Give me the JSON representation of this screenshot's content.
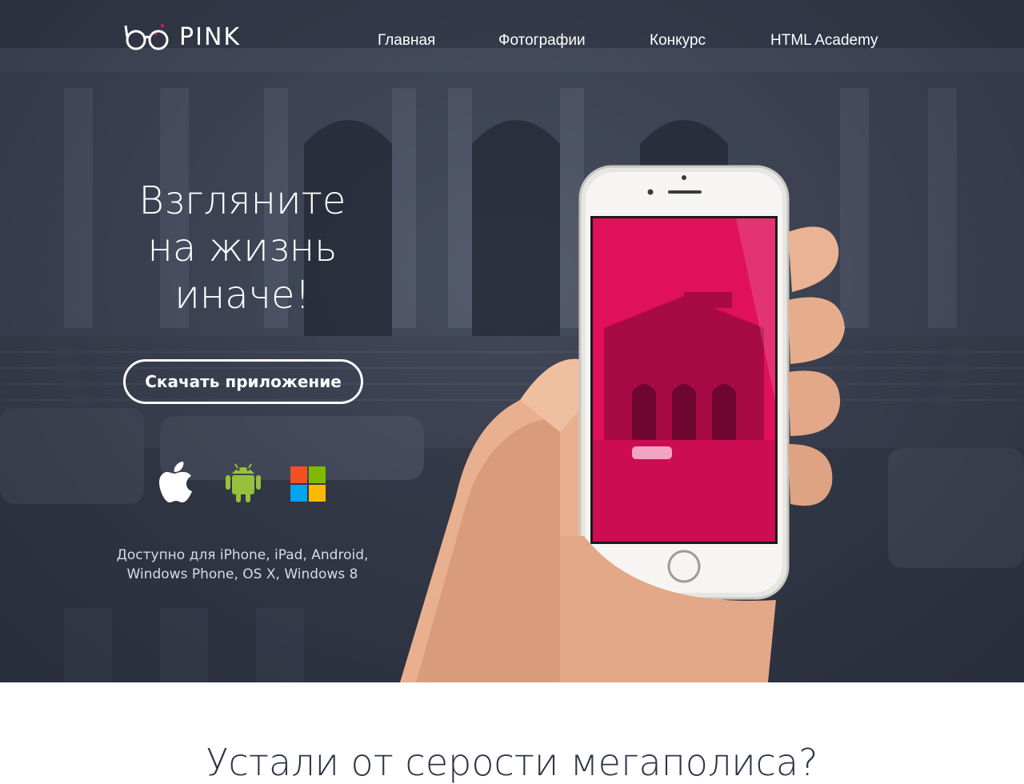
{
  "header": {
    "logo_text": "PINK",
    "nav": [
      {
        "label": "Главная"
      },
      {
        "label": "Фотографии"
      },
      {
        "label": "Конкурс"
      },
      {
        "label": "HTML Academy"
      }
    ]
  },
  "hero": {
    "headline_lines": [
      "Взгляните",
      "на жизнь",
      "иначе!"
    ],
    "download_button": "Скачать приложение",
    "platform_icons": [
      "apple-icon",
      "android-icon",
      "windows-icon"
    ],
    "available_lines": [
      "Доступно для iPhone, iPad, Android,",
      "Windows Phone, OS X, Windows 8"
    ]
  },
  "next_section": {
    "title": "Устали от серости мегаполиса?"
  },
  "colors": {
    "accent_pink": "#e0105a",
    "hero_overlay": "#2e3444",
    "text_dark": "#2d3446"
  }
}
